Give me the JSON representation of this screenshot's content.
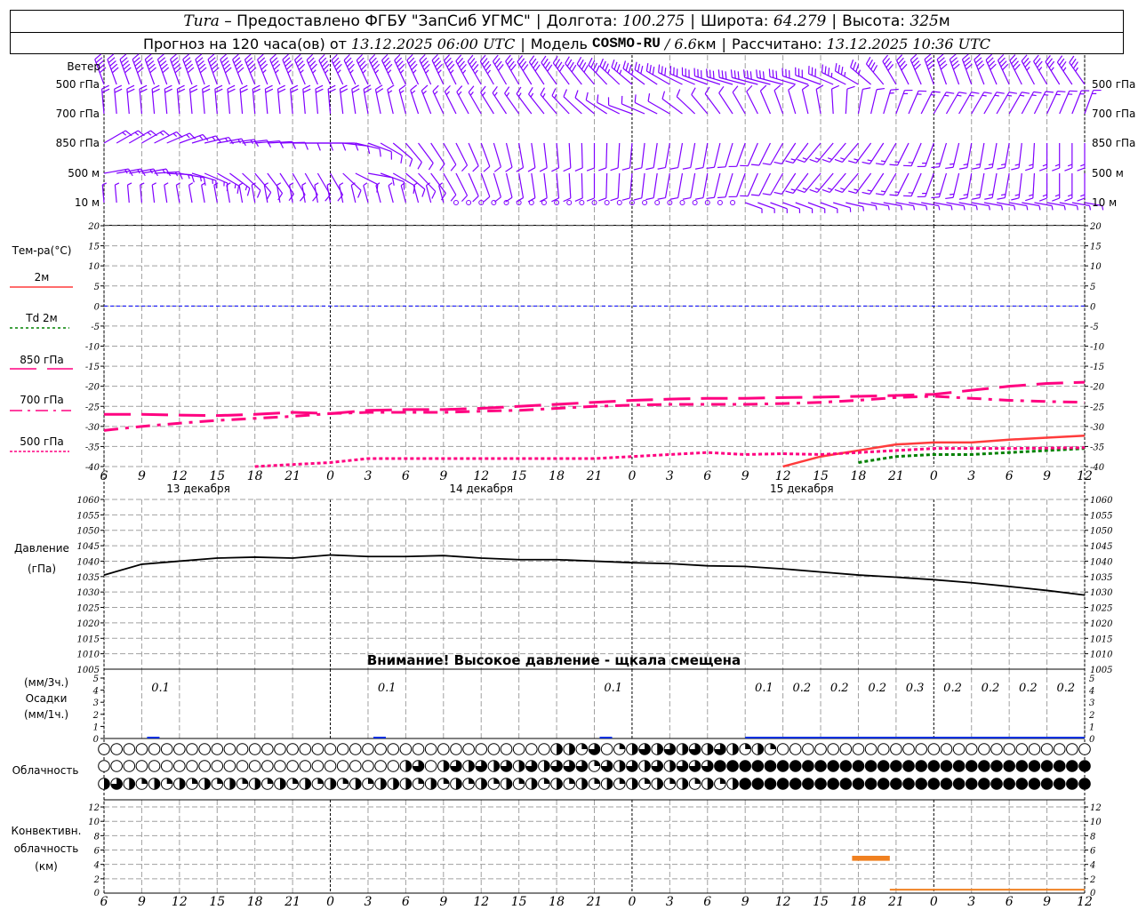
{
  "header": {
    "station": "Tura",
    "provider": " – Предоставлено ФГБУ \"ЗапСиб УГМС\"",
    "lon_label": "Долгота: ",
    "lon": "100.275",
    "lat_label": "Широта: ",
    "lat": "64.279",
    "alt_label": "Высота: ",
    "alt": "325",
    "alt_unit": "м",
    "forecast_label": "Прогноз на 120 часа(ов) от ",
    "forecast_start": "13.12.2025 06:00 UTC",
    "model_label": "Модель ",
    "model": "COSMO-RU",
    "model_res": " / 6.6",
    "model_res_unit": "км",
    "calc_label": "Рассчитано: ",
    "calc_time": "13.12.2025 10:36 UTC"
  },
  "labels": {
    "wind": "Ветер",
    "wind_levels": [
      "500 гПа",
      "700 гПа",
      "850 гПа",
      "500 м",
      "10  м"
    ],
    "temp_title": "Тем-ра(°C)",
    "temp_2m": "2м",
    "td_2m": "Td  2м",
    "t850": "850 гПа",
    "t700": "700 гПа",
    "t500": "500 гПа",
    "pressure": "Давление",
    "pressure_unit": "(гПа)",
    "warning": "Внимание! Высокое давление - щкала смещена",
    "precip_3h": "(мм/3ч.)",
    "precip": "Осадки",
    "precip_1h": "(мм/1ч.)",
    "cloud": "Облачность",
    "conv1": "Конвективн.",
    "conv2": "облачность",
    "conv3": "(км)"
  },
  "colors": {
    "wind": "#8000ff",
    "t2m": "#ff3b3b",
    "td2m": "#008000",
    "upper": "#ff0080",
    "zero": "#0000ff",
    "precip": "#0030e0",
    "conv": "#f08020",
    "grid": "#a0a0a0"
  },
  "chart_data": {
    "type": "line",
    "x_ticks": [
      "6",
      "9",
      "12",
      "15",
      "18",
      "21",
      "0",
      "3",
      "6",
      "9",
      "12",
      "15",
      "18",
      "21",
      "0",
      "3",
      "6",
      "9",
      "12",
      "15",
      "18",
      "21",
      "0",
      "3",
      "6",
      "9",
      "12"
    ],
    "day_labels": [
      {
        "tick": 2.5,
        "label": "13 декабря"
      },
      {
        "tick": 10,
        "label": "14 декабря"
      },
      {
        "tick": 18.5,
        "label": "15 декабря"
      }
    ],
    "wind": {
      "levels": [
        "500hPa",
        "700hPa",
        "850hPa",
        "500m",
        "10m"
      ],
      "direction_deg": [
        [
          340,
          340,
          340,
          340,
          338,
          338,
          335,
          335,
          335,
          335,
          330,
          330,
          325,
          320,
          310,
          300,
          290,
          285,
          285,
          290,
          300,
          330,
          340,
          340,
          335,
          330,
          325
        ],
        [
          355,
          355,
          355,
          355,
          355,
          355,
          355,
          350,
          345,
          335,
          330,
          325,
          320,
          310,
          290,
          300,
          320,
          330,
          340,
          350,
          10,
          20,
          30,
          30,
          30,
          25,
          20
        ],
        [
          60,
          60,
          70,
          80,
          85,
          90,
          90,
          110,
          140,
          150,
          160,
          170,
          175,
          180,
          185,
          190,
          190,
          200,
          210,
          220,
          220,
          210,
          200,
          190,
          190,
          180,
          180
        ],
        [
          80,
          80,
          100,
          120,
          140,
          150,
          150,
          100,
          130,
          150,
          160,
          170,
          175,
          180,
          185,
          190,
          190,
          200,
          210,
          220,
          220,
          210,
          200,
          190,
          190,
          180,
          180
        ],
        [
          355,
          355,
          350,
          350,
          350,
          350,
          350,
          345,
          345,
          345,
          0,
          0,
          0,
          0,
          0,
          0,
          0,
          110,
          110,
          110,
          100,
          100,
          100,
          100,
          100,
          100,
          100
        ]
      ],
      "speed_kt": [
        [
          50,
          50,
          50,
          48,
          48,
          45,
          45,
          45,
          45,
          45,
          45,
          40,
          40,
          40,
          35,
          30,
          30,
          30,
          30,
          30,
          35,
          40,
          40,
          40,
          40,
          35,
          35
        ],
        [
          20,
          20,
          20,
          20,
          20,
          20,
          20,
          20,
          15,
          15,
          15,
          15,
          15,
          10,
          10,
          10,
          10,
          10,
          10,
          10,
          10,
          15,
          15,
          15,
          15,
          15,
          15
        ],
        [
          15,
          15,
          15,
          15,
          10,
          10,
          10,
          10,
          10,
          10,
          10,
          10,
          10,
          10,
          10,
          10,
          10,
          10,
          10,
          15,
          15,
          15,
          15,
          15,
          15,
          15,
          15
        ],
        [
          15,
          15,
          15,
          15,
          10,
          10,
          10,
          10,
          10,
          10,
          10,
          10,
          10,
          10,
          10,
          10,
          10,
          10,
          10,
          15,
          15,
          15,
          15,
          15,
          15,
          15,
          15
        ],
        [
          5,
          5,
          5,
          5,
          5,
          5,
          5,
          5,
          5,
          5,
          0,
          0,
          0,
          0,
          0,
          0,
          0,
          5,
          5,
          5,
          5,
          5,
          5,
          5,
          5,
          5,
          5
        ]
      ]
    },
    "temperature": {
      "ylim": [
        -40,
        20
      ],
      "yticks": [
        20,
        15,
        10,
        5,
        0,
        -5,
        -10,
        -15,
        -20,
        -25,
        -30,
        -35,
        -40
      ],
      "series": [
        {
          "name": "2м",
          "key": "t2m",
          "values": [
            null,
            null,
            null,
            null,
            null,
            null,
            null,
            null,
            null,
            null,
            null,
            null,
            null,
            null,
            null,
            null,
            null,
            null,
            -40,
            -37.5,
            -36,
            -34.5,
            -34,
            -34,
            -33.3,
            -32.8,
            -32.3
          ]
        },
        {
          "name": "Td 2м",
          "key": "td2m",
          "values": [
            null,
            null,
            null,
            null,
            null,
            null,
            null,
            null,
            null,
            null,
            null,
            null,
            null,
            null,
            null,
            null,
            null,
            null,
            null,
            null,
            -39,
            -37.5,
            -37,
            -37,
            -36.5,
            -36,
            -35.5
          ]
        },
        {
          "name": "850 гПа",
          "key": "t850",
          "values": [
            -27,
            -27,
            -27.2,
            -27.3,
            -27,
            -26.5,
            -26.8,
            -26,
            -25.8,
            -25.8,
            -25.5,
            -25,
            -24.5,
            -24,
            -23.5,
            -23.2,
            -23,
            -23,
            -22.8,
            -22.7,
            -22.5,
            -22.3,
            -22,
            -21,
            -20,
            -19.3,
            -19
          ]
        },
        {
          "name": "700 гПа",
          "key": "t700",
          "values": [
            -31,
            -30,
            -29.2,
            -28.5,
            -28,
            -27.5,
            -26.8,
            -26.5,
            -26.5,
            -26.5,
            -26.2,
            -26,
            -25.5,
            -25,
            -24.7,
            -24.5,
            -24.5,
            -24.5,
            -24.3,
            -24,
            -23.5,
            -22.8,
            -22.5,
            -23,
            -23.5,
            -23.8,
            -24
          ]
        },
        {
          "name": "500 гПа",
          "key": "t500",
          "values": [
            null,
            null,
            null,
            null,
            -40,
            -39.5,
            -39,
            -38,
            -38,
            -38,
            -38,
            -38,
            -38,
            -38,
            -37.5,
            -37,
            -36.5,
            -37,
            -36.8,
            -37,
            -36.5,
            -36,
            -35.5,
            -35.5,
            -35.5,
            -35.4,
            -35.3
          ]
        }
      ]
    },
    "pressure": {
      "ylim": [
        1005,
        1060
      ],
      "yticks": [
        1060,
        1055,
        1050,
        1045,
        1040,
        1035,
        1030,
        1025,
        1020,
        1015,
        1010,
        1005
      ],
      "values": [
        1035.5,
        1039,
        1040,
        1041,
        1041.3,
        1041,
        1042,
        1041.5,
        1041.5,
        1041.8,
        1041,
        1040.5,
        1040.5,
        1040,
        1039.5,
        1039.2,
        1038.5,
        1038.3,
        1037.5,
        1036.5,
        1035.5,
        1034.8,
        1034,
        1033,
        1031.8,
        1030.5,
        1029
      ]
    },
    "precipitation": {
      "ylim": [
        0,
        5
      ],
      "yticks": [
        5,
        4,
        3,
        2,
        1,
        0
      ],
      "interval_3h_mm": [
        0,
        0.1,
        0,
        0,
        0,
        0,
        0,
        0.1,
        0,
        0,
        0,
        0,
        0,
        0.1,
        0,
        0,
        0,
        0.1,
        0.2,
        0.2,
        0.2,
        0.3,
        0.2,
        0.2,
        0.2,
        0.2
      ]
    },
    "cloudiness_quarters": {
      "high": "0000000000000000000000000000000000002213012323232321210000000000000000000000000",
      "middle": "0000000000000000000000002302323232323331323232333444444444444444444444444444444",
      "low": "2321212121212121212121222121212121212121212121212124444444444444444444444444444"
    },
    "convective": {
      "ylim": [
        0,
        13
      ],
      "yticks": [
        12,
        10,
        8,
        6,
        4,
        2,
        0
      ],
      "layers": [
        {
          "from": "15.12 17:30",
          "to": "15.12 20:30",
          "bottom_km": 4.5,
          "top_km": 5.2
        },
        {
          "from": "15.12 20:30",
          "to": "16.12 12:00",
          "bottom_km": 0.5,
          "top_km": 0.6
        }
      ]
    }
  }
}
